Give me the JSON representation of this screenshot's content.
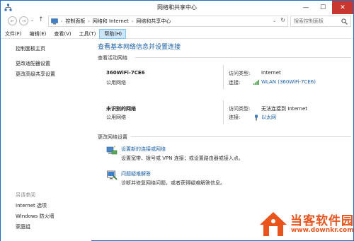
{
  "window": {
    "title": "网络和共享中心"
  },
  "titlebar": {
    "min": "—",
    "max": "☐",
    "close": "✕"
  },
  "nav": {
    "back": "←",
    "forward": "→",
    "dropdown": "⌄",
    "up": "↑"
  },
  "breadcrumb": {
    "sep": "›",
    "items": [
      "控制面板",
      "网络和 Internet",
      "网络和共享中心"
    ],
    "refresh": "↻"
  },
  "search": {
    "placeholder": "搜索控制面板"
  },
  "menu": [
    {
      "label": "文件(F)"
    },
    {
      "label": "编辑(E)"
    },
    {
      "label": "查看(V)"
    },
    {
      "label": "工具(T)"
    },
    {
      "label": "帮助(H)",
      "active": true
    }
  ],
  "sidebar": {
    "links": [
      "控制面板主页",
      "更改适配器设置",
      "更改高级共享设置"
    ],
    "see_also_label": "另请参阅",
    "see_also": [
      "Internet 选项",
      "Windows 防火墙",
      "家庭组"
    ]
  },
  "main": {
    "title": "查看基本网络信息并设置连接",
    "active_label": "查看活动网络",
    "networks": [
      {
        "name": "360WiFi-7CE6",
        "type": "公用网络",
        "access_key": "访问类型:",
        "access_val": "Internet",
        "conn_key": "连接:",
        "conn_val": "WLAN (360WiFi-7CE6)",
        "conn_icon": "wifi-signal-icon"
      },
      {
        "name": "未识别的网络",
        "type": "公用网络",
        "access_key": "访问类型:",
        "access_val": "无法连接到 Internet",
        "conn_key": "连接:",
        "conn_val": "以太网",
        "conn_icon": "ethernet-icon"
      }
    ],
    "change_label": "更改网络设置",
    "tasks": [
      {
        "title": "设置新的连接或网络",
        "desc": "设置宽带、拨号或 VPN 连接；或设置路由器或接入点。",
        "icon": "new-connection-icon"
      },
      {
        "title": "问题疑难解答",
        "desc": "诊断并修复网络问题，或者获得疑难解答信息。",
        "icon": "troubleshoot-icon"
      }
    ]
  },
  "watermark": {
    "text": "当客软件园",
    "url": "www.downkr.com"
  },
  "colors": {
    "link": "#1a5fa8",
    "accent": "#1e6fc1",
    "close": "#c7372f",
    "watermark": "#e8541c"
  }
}
